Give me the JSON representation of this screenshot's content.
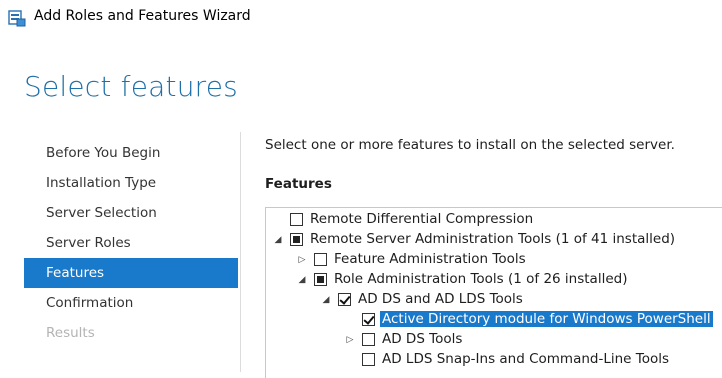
{
  "window": {
    "title": "Add Roles and Features Wizard"
  },
  "page": {
    "title": "Select features"
  },
  "nav": {
    "items": [
      {
        "label": "Before You Begin",
        "state": "normal"
      },
      {
        "label": "Installation Type",
        "state": "normal"
      },
      {
        "label": "Server Selection",
        "state": "normal"
      },
      {
        "label": "Server Roles",
        "state": "normal"
      },
      {
        "label": "Features",
        "state": "active"
      },
      {
        "label": "Confirmation",
        "state": "normal"
      },
      {
        "label": "Results",
        "state": "disabled"
      }
    ]
  },
  "main": {
    "instructions": "Select one or more features to install on the selected server.",
    "features_label": "Features",
    "tree": [
      {
        "label": "Remote Differential Compression",
        "level": 0,
        "expander": "none",
        "check": "unchecked",
        "selected": false
      },
      {
        "label": "Remote Server Administration Tools (1 of 41 installed)",
        "level": 0,
        "expander": "expanded",
        "check": "partial",
        "selected": false
      },
      {
        "label": "Feature Administration Tools",
        "level": 1,
        "expander": "collapsed",
        "check": "unchecked",
        "selected": false
      },
      {
        "label": "Role Administration Tools (1 of 26 installed)",
        "level": 1,
        "expander": "expanded",
        "check": "partial",
        "selected": false
      },
      {
        "label": "AD DS and AD LDS Tools",
        "level": 2,
        "expander": "expanded",
        "check": "checked",
        "selected": false
      },
      {
        "label": "Active Directory module for Windows PowerShell",
        "level": 3,
        "expander": "none",
        "check": "checked",
        "selected": true
      },
      {
        "label": "AD DS Tools",
        "level": 3,
        "expander": "collapsed",
        "check": "unchecked",
        "selected": false
      },
      {
        "label": "AD LDS Snap-Ins and Command-Line Tools",
        "level": 3,
        "expander": "none",
        "check": "unchecked",
        "selected": false
      }
    ]
  },
  "colors": {
    "accent": "#1979ca",
    "title": "#1f6fa8",
    "disabled": "#b4b4b4"
  }
}
